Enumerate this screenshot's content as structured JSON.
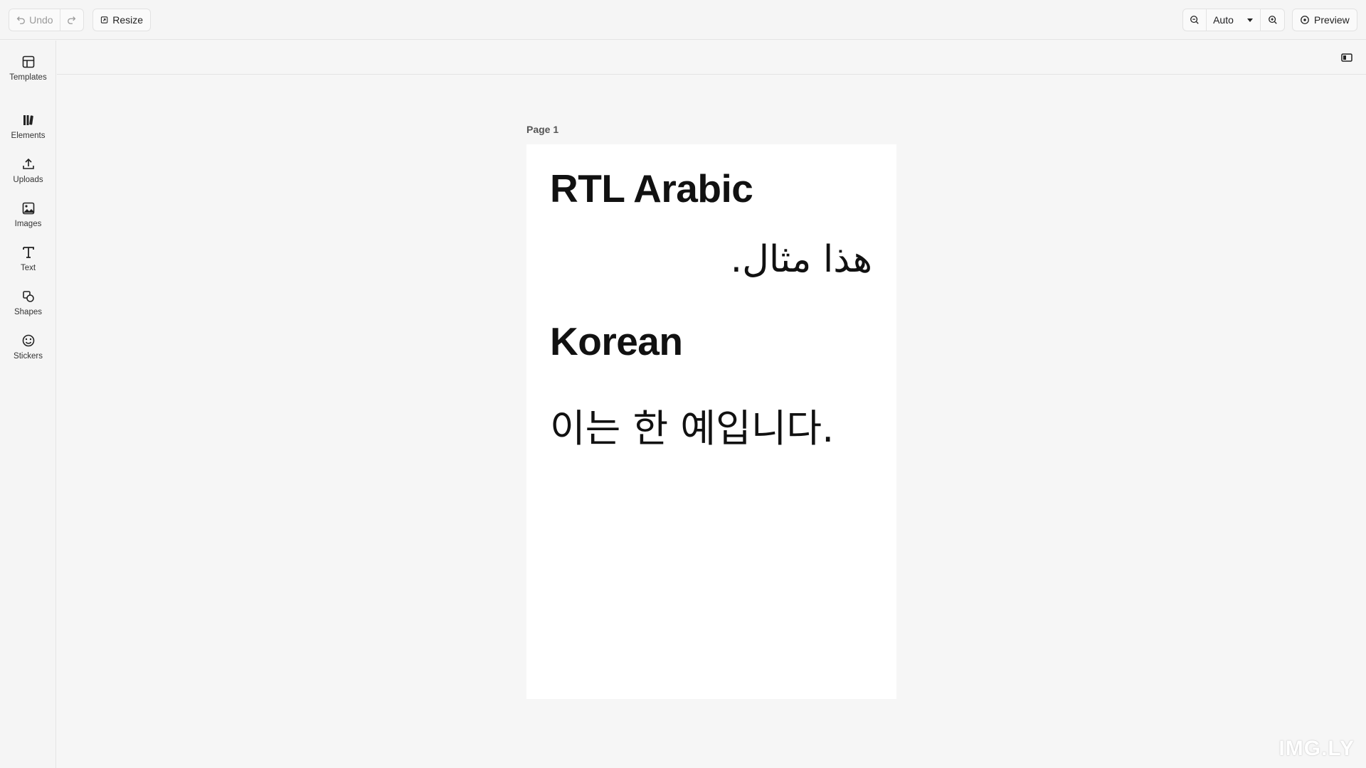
{
  "toolbar": {
    "undo_label": "Undo",
    "resize_label": "Resize",
    "zoom_value": "Auto",
    "preview_label": "Preview"
  },
  "sidebar": {
    "items": [
      {
        "label": "Templates",
        "icon": "templates-icon"
      },
      {
        "label": "Elements",
        "icon": "elements-icon"
      },
      {
        "label": "Uploads",
        "icon": "upload-icon"
      },
      {
        "label": "Images",
        "icon": "image-icon"
      },
      {
        "label": "Text",
        "icon": "text-icon"
      },
      {
        "label": "Shapes",
        "icon": "shapes-icon"
      },
      {
        "label": "Stickers",
        "icon": "sticker-icon"
      }
    ]
  },
  "canvas": {
    "page_label": "Page 1",
    "heading_arabic": "RTL Arabic",
    "arabic_text": "هذا مثال.",
    "heading_korean": "Korean",
    "korean_text": "이는 한 예입니다."
  },
  "watermark": "IMG.LY"
}
